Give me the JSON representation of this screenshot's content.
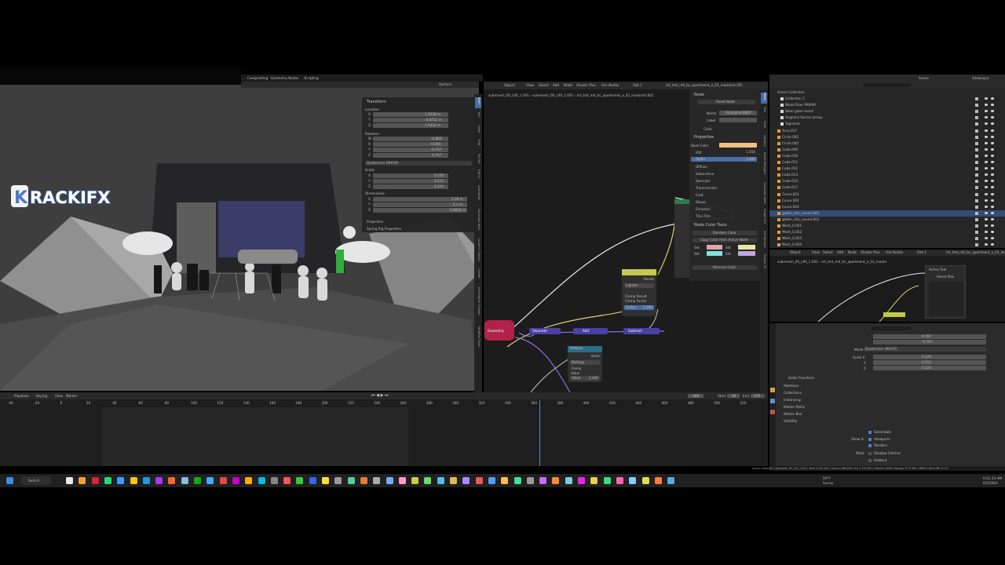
{
  "overlay": {
    "logo_text": "RACKIFX",
    "logo_letter": "K"
  },
  "workspace_tabs": [
    "Compositing",
    "Geometry Nodes",
    "Scripting"
  ],
  "viewport": {
    "options_label": "Options"
  },
  "transform_panel": {
    "title": "Transform",
    "location_label": "Location:",
    "location": [
      {
        "axis": "X",
        "value": "1.9338 m"
      },
      {
        "axis": "Y",
        "value": "-0.8712 m"
      },
      {
        "axis": "Z",
        "value": "2.9332 m"
      }
    ],
    "rotation_label": "Rotation:",
    "rotation": [
      {
        "axis": "W",
        "value": "-0.860"
      },
      {
        "axis": "X",
        "value": "0.000"
      },
      {
        "axis": "Y",
        "value": "-0.707"
      },
      {
        "axis": "Z",
        "value": "-0.707"
      }
    ],
    "rotation_mode": "Quaternion (WXYZ)",
    "scale_label": "Scale:",
    "scale": [
      {
        "axis": "X",
        "value": "0.220"
      },
      {
        "axis": "Y",
        "value": "0.515"
      },
      {
        "axis": "Z",
        "value": "0.224"
      }
    ],
    "dimensions_label": "Dimensions:",
    "dimensions": [
      {
        "axis": "X",
        "value": "5.29 m"
      },
      {
        "axis": "Y",
        "value": "2.1 m"
      },
      {
        "axis": "Z",
        "value": "0.6645 m"
      }
    ],
    "properties_label": "Properties",
    "spring_label": "Spring Rig Properties"
  },
  "viewport_tabs": [
    "Item",
    "Tool",
    "View",
    "Edit",
    "Pie Me",
    "Rig UI",
    "Animation",
    "Gaussian Rain",
    "Launch Control",
    "Create",
    "Procedural Crowds",
    "Modifier Tools"
  ],
  "node_editor": {
    "header_items": [
      "Object",
      "View",
      "Select",
      "Add",
      "Node",
      "Shader Plus",
      "Use Nodes",
      "Slot 1"
    ],
    "material_name": "mt_tmt_mtl_bc_apartment_a_02_masksmt.001",
    "breadcrumb": [
      "subrmesh_00_L00_1.001",
      "subrmesh_00_L00_1.001",
      "mt_tmt_mtl_bc_apartment_a_02_masksmt.001"
    ],
    "nodes": {
      "geometry": "Geometry",
      "lighten": "Lighten",
      "lighten_result": "Result",
      "lighten_mode": "Lighten",
      "clamp_result": "Clamp Result",
      "clamp_factor": "Clamp Factor",
      "factor_label": "Factor",
      "factor_value": "0.300",
      "multiply": "Multiply",
      "multiply_mode": "Multiply",
      "clamp": "Clamp",
      "value_label": "Value",
      "value2_label": "Value",
      "value2": "2.400",
      "add": "Add",
      "subtract": "Subtract",
      "separate": "Separate"
    }
  },
  "node_panel": {
    "node_title": "Node",
    "reset_label": "Reset Node",
    "name_label": "Name",
    "name_value": "Principled BSDF",
    "label_label": "Label",
    "color_label": "Color",
    "properties_title": "Properties",
    "base_color": "Base Color",
    "ior_label": "IOR",
    "ior_value": "1.450",
    "alpha_label": "Alpha",
    "alpha_value": "1.000",
    "sections": [
      "Diffuse",
      "Subsurface",
      "Specular",
      "Transmission",
      "Coat",
      "Sheen",
      "Emission",
      "Thin Film"
    ],
    "tools_title": "Node Color Tools",
    "random_color": "Random Color",
    "copy_color": "Copy Color from Active Node",
    "set_labels": [
      "Set",
      "Set",
      "Set",
      "Set"
    ],
    "remove_color": "Remove Color",
    "swatch_colors": [
      "#e3a3a8",
      "#7ee3dc",
      "#e8e8a0",
      "#c3a6e8"
    ],
    "base_color_hex": "#f0c080"
  },
  "node_tabs": [
    "Node",
    "Tool",
    "View",
    "Options",
    "Node Wrangler",
    "Gaussian Data",
    "Graph Pro",
    "Set Bounce",
    "Ember FX"
  ],
  "outliner": {
    "title": "Scene Collection",
    "items": [
      "Collection 1",
      "Wood Door PARAM",
      "Steel glass social",
      "Angelica Soccer Jersey",
      "Tagname",
      "Area.017",
      "Circle.005",
      "Circle.004",
      "Cube.009",
      "Cube.010",
      "Cube.011",
      "Cube.012",
      "Cube.013",
      "Cube.014",
      "Cube.017",
      "Curve.001",
      "Curve.002",
      "Curve.003",
      "goblin_disc_sound.001",
      "goblin_disc_sound.002",
      "Mesh_0.001",
      "Mesh_0.002",
      "Mesh_0.003",
      "Mesh_0.004"
    ],
    "scene_label": "Scene",
    "viewlayer_label": "ViewLayer"
  },
  "node2": {
    "header_items": [
      "Object",
      "View",
      "Select",
      "Add",
      "Node",
      "Shader Plus",
      "Use Nodes",
      "Slot 1"
    ],
    "material_name": "mt_tmt_mtl_bc_apartment_a_02_masks",
    "breadcrumb": [
      "subrmesh_00_L00_1.001",
      "mt_tmt_mtl_bc_apartment_a_02_masks"
    ],
    "active_tool": "Active Tool",
    "select_box": "Select Box"
  },
  "properties": {
    "w_value": "0.707",
    "z_value": "-0.707",
    "mode_label": "Mode",
    "mode_value": "Quaternion (WXYZ)",
    "scale_x_label": "Scale X",
    "scale_x": "0.220",
    "scale_y_label": "Y",
    "scale_y": "0.515",
    "scale_z_label": "Z",
    "scale_z": "0.224",
    "delta_transform": "Delta Transform",
    "relations": "Relations",
    "collections": "Collections",
    "instancing": "Instancing",
    "motion_paths": "Motion Paths",
    "motion_blur": "Motion Blur",
    "visibility": "Visibility",
    "selectable": "Selectable",
    "show_in": "Show In",
    "viewports": "Viewports",
    "renders": "Renders",
    "mask": "Mask",
    "shadow_catcher": "Shadow Catcher",
    "holdout": "Holdout"
  },
  "timeline": {
    "menu": [
      "Playback",
      "Keying",
      "View",
      "Marker"
    ],
    "current_frame": "368",
    "start_label": "Start",
    "start_value": "30",
    "end_label": "End",
    "end_value": "370",
    "ticks": [
      "-40",
      "-20",
      "0",
      "20",
      "40",
      "60",
      "80",
      "100",
      "120",
      "140",
      "160",
      "180",
      "200",
      "220",
      "240",
      "260",
      "280",
      "300",
      "320",
      "340",
      "360",
      "380",
      "400",
      "420",
      "440",
      "460",
      "480",
      "500",
      "520"
    ],
    "playhead_frame": 368,
    "tick_min": -40,
    "tick_step": 20
  },
  "statusbar": {
    "text": "Scene Collection | subrmesh_00_L00_1.001 | Verts 2,974,424 | Faces 2,466,946 | Tris 5,133,632 | Objects 1/496 | Memory 5.70 GiB | VRAM 3.8/24 GiB | 4.2.0"
  },
  "taskbar": {
    "search_label": "Search",
    "weather_temp": "59°F",
    "weather_text": "Sunny",
    "time": "9:41:33 AM",
    "date": "6/1/2024"
  }
}
